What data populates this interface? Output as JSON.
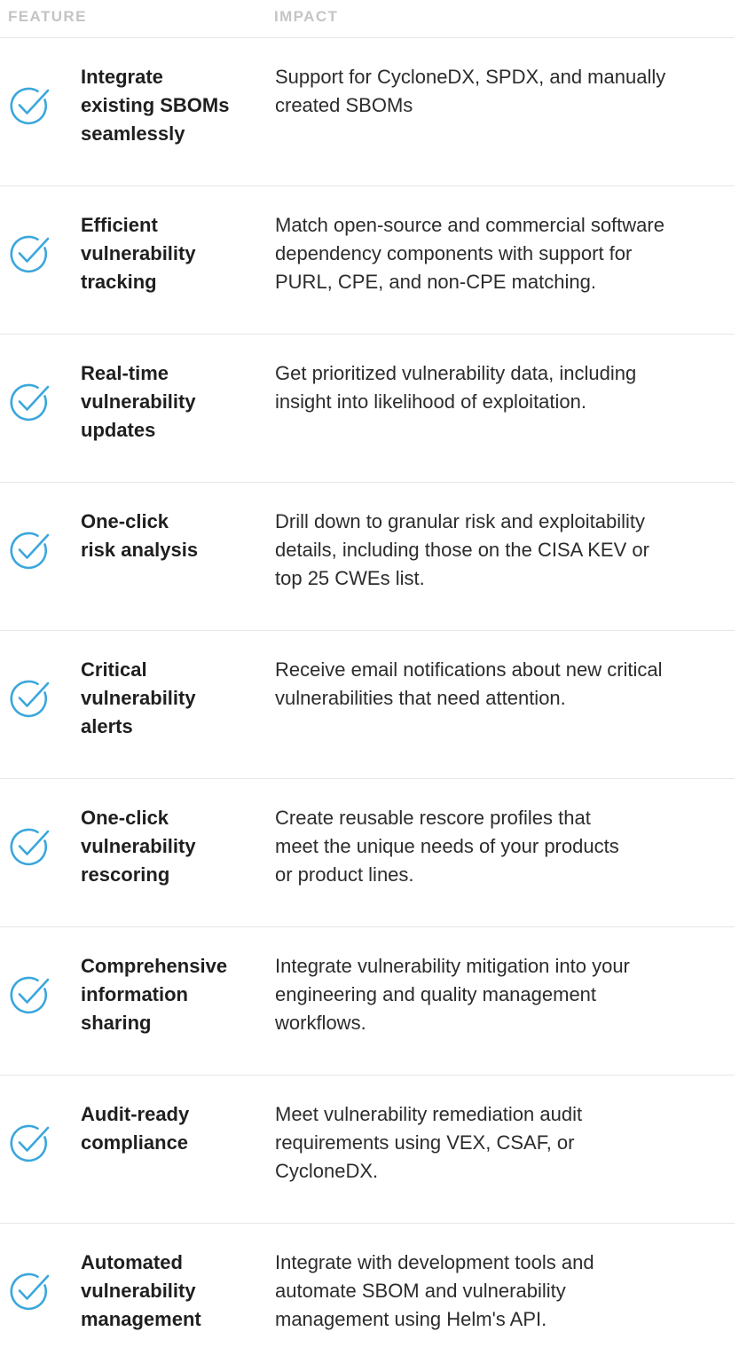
{
  "header": {
    "feature": "FEATURE",
    "impact": "IMPACT"
  },
  "colors": {
    "check": "#3aa7dc",
    "header_text": "#c4c4c4",
    "divider": "#e6e6e6"
  },
  "rows": [
    {
      "icon": "check-circle-icon",
      "feature": [
        "Integrate",
        "existing SBOMs",
        "seamlessly"
      ],
      "impact": [
        "Support for CycloneDX, SPDX, and manually",
        "created SBOMs"
      ]
    },
    {
      "icon": "check-circle-icon",
      "feature": [
        "Efficient",
        "vulnerability",
        "tracking"
      ],
      "impact": [
        "Match open-source and commercial software",
        "dependency components with support for",
        "PURL, CPE, and non-CPE matching."
      ]
    },
    {
      "icon": "check-circle-icon",
      "feature": [
        "Real-time",
        "vulnerability",
        "updates"
      ],
      "impact": [
        "Get prioritized vulnerability data, including",
        "insight into likelihood of exploitation."
      ]
    },
    {
      "icon": "check-circle-icon",
      "feature": [
        "One-click",
        "risk analysis"
      ],
      "impact": [
        "Drill down to granular risk and exploitability",
        "details, including those on the CISA KEV or",
        "top 25 CWEs list."
      ]
    },
    {
      "icon": "check-circle-icon",
      "feature": [
        "Critical",
        "vulnerability",
        "alerts"
      ],
      "impact": [
        "Receive email notifications about new critical",
        "vulnerabilities that need attention."
      ]
    },
    {
      "icon": "check-circle-icon",
      "feature": [
        "One-click",
        "vulnerability",
        "rescoring"
      ],
      "impact": [
        "Create reusable rescore profiles that",
        "meet the unique needs of your products",
        "or product lines."
      ]
    },
    {
      "icon": "check-circle-icon",
      "feature": [
        "Comprehensive",
        "information",
        "sharing"
      ],
      "impact": [
        "Integrate vulnerability mitigation into your",
        "engineering and quality management",
        "workflows."
      ]
    },
    {
      "icon": "check-circle-icon",
      "feature": [
        "Audit-ready",
        "compliance"
      ],
      "impact": [
        "Meet vulnerability remediation audit",
        "requirements using VEX, CSAF, or",
        "CycloneDX."
      ]
    },
    {
      "icon": "check-circle-icon",
      "feature": [
        "Automated",
        "vulnerability",
        "management"
      ],
      "impact": [
        "Integrate with development tools and",
        "automate SBOM and vulnerability",
        "management using Helm's API."
      ]
    }
  ]
}
